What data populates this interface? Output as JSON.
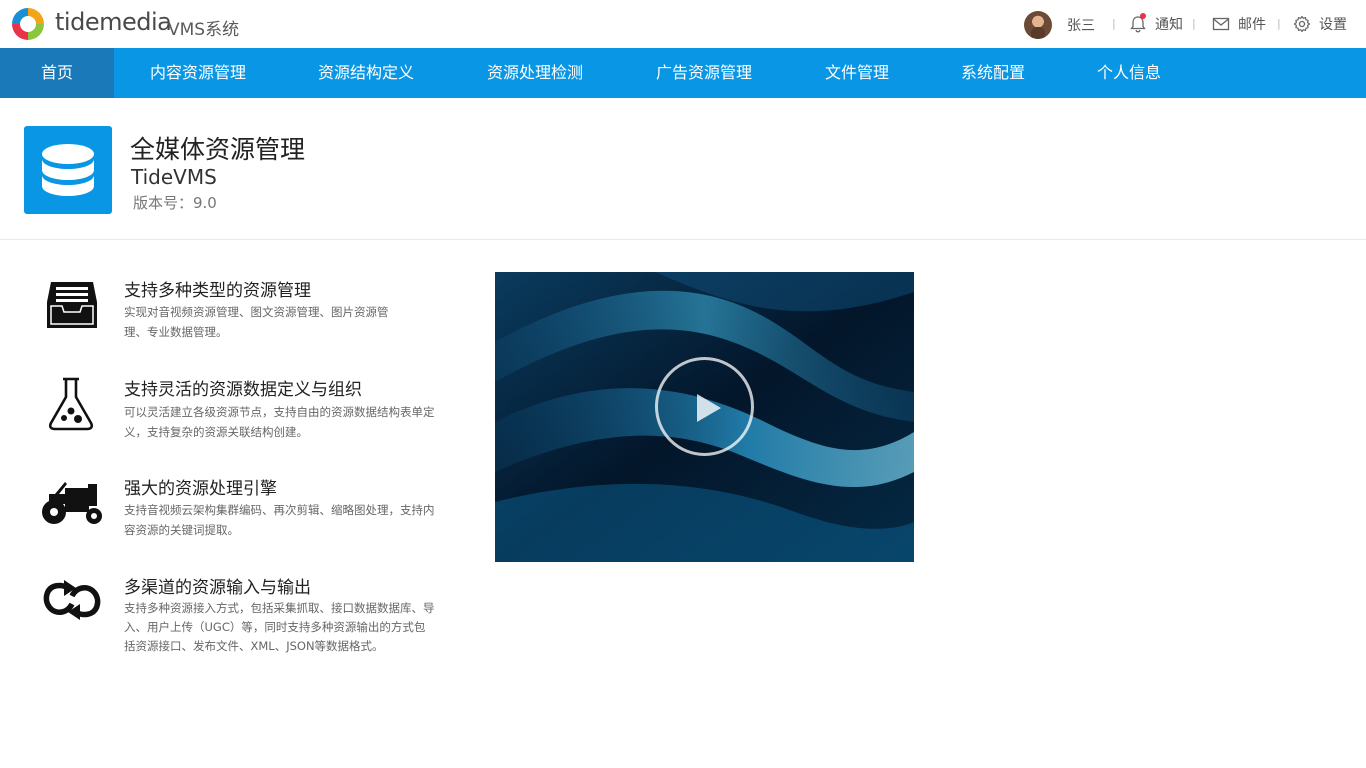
{
  "header": {
    "brand": "tidemedia",
    "brand_sub": "VMS系统",
    "user_name": "张三",
    "separator": "|",
    "notify_label": "通知",
    "mail_label": "邮件",
    "settings_label": "设置"
  },
  "nav": {
    "items": [
      "首页",
      "内容资源管理",
      "资源结构定义",
      "资源处理检测",
      "广告资源管理",
      "文件管理",
      "系统配置",
      "个人信息"
    ],
    "active_index": 0
  },
  "product": {
    "title": "全媒体资源管理",
    "name": "TideVMS",
    "version": "版本号：9.0"
  },
  "features": [
    {
      "icon": "inbox-tray-icon",
      "title": "支持多种类型的资源管理",
      "desc_lines": [
        "实现对音视频资源管理、图文资源管理、图片资源管",
        "理、专业数据管理。"
      ]
    },
    {
      "icon": "flask-icon",
      "title": "支持灵活的资源数据定义与组织",
      "desc_lines": [
        "可以灵活建立各级资源节点，支持自由的资源数据结构表单定",
        "义，支持复杂的资源关联结构创建。"
      ]
    },
    {
      "icon": "tractor-icon",
      "title": "强大的资源处理引擎",
      "desc_lines": [
        "支持音视频云架构集群编码、再次剪辑、缩略图处理，支持内",
        "容资源的关键词提取。"
      ]
    },
    {
      "icon": "refresh-arrows-icon",
      "title": "多渠道的资源输入与输出",
      "desc_lines": [
        "支持多种资源接入方式，包括采集抓取、接口数据数据库、导",
        "入、用户上传（UGC）等，同时支持多种资源输出的方式包",
        "括资源接口、发布文件、XML、JSON等数据格式。"
      ]
    }
  ],
  "colors": {
    "nav_bg": "#0996e5",
    "nav_active": "#1a79b8",
    "icon_bg": "#0996e5",
    "notify_dot": "#e8334b"
  }
}
